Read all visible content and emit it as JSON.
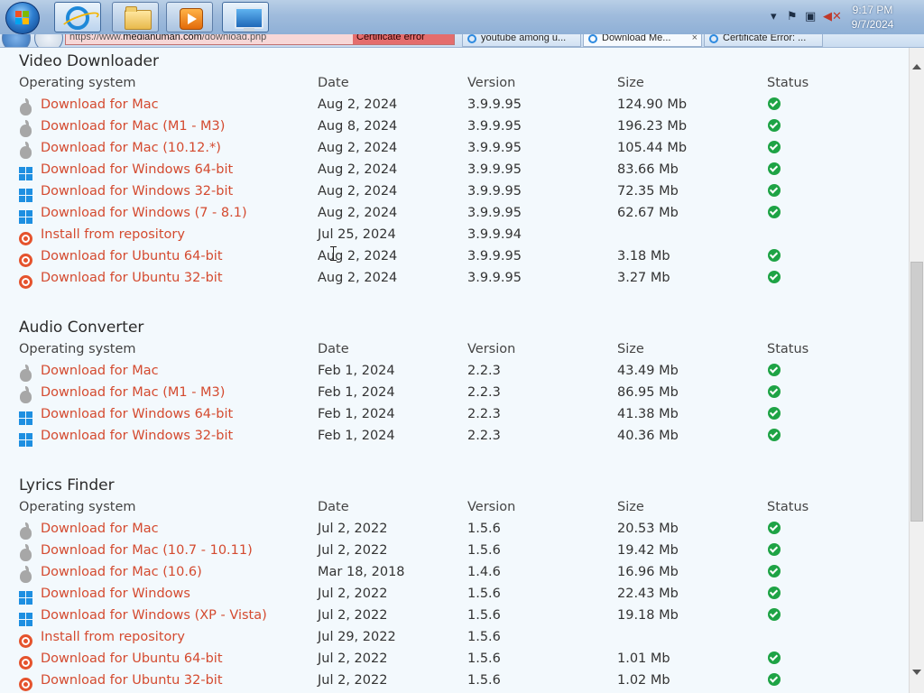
{
  "taskbar": {
    "clock_time": "9:17 PM",
    "clock_date": "9/7/2024",
    "apps": [
      "internet-explorer",
      "file-explorer",
      "media-player",
      "remote-desktop"
    ]
  },
  "browser": {
    "address_host": "mediahuman.com",
    "address_rest": "/download.php",
    "address_prefix": "https://www.",
    "cert_label": "Certificate error",
    "tabs": [
      {
        "label": "youtube among u...",
        "active": false
      },
      {
        "label": "Download Me...",
        "active": true
      },
      {
        "label": "Certificate Error: ...",
        "active": false
      }
    ],
    "tab_close": "×"
  },
  "colors": {
    "link": "#d44a2f",
    "status_ok": "#1ea345",
    "windows_blue": "#1e8fe1",
    "ubuntu_orange": "#e5532d",
    "apple_gray": "#a7a7a7"
  },
  "headers": {
    "os": "Operating system",
    "date": "Date",
    "version": "Version",
    "size": "Size",
    "status": "Status"
  },
  "sections": [
    {
      "title": "Video Downloader",
      "rows": [
        {
          "icon": "apple",
          "label": "Download for Mac",
          "date": "Aug 2, 2024",
          "version": "3.9.9.95",
          "size": "124.90 Mb",
          "ok": true
        },
        {
          "icon": "apple",
          "label": "Download for Mac (M1 - M3)",
          "date": "Aug 8, 2024",
          "version": "3.9.9.95",
          "size": "196.23 Mb",
          "ok": true
        },
        {
          "icon": "apple",
          "label": "Download for Mac (10.12.*)",
          "date": "Aug 2, 2024",
          "version": "3.9.9.95",
          "size": "105.44 Mb",
          "ok": true
        },
        {
          "icon": "windows",
          "label": "Download for Windows 64-bit",
          "date": "Aug 2, 2024",
          "version": "3.9.9.95",
          "size": "83.66 Mb",
          "ok": true
        },
        {
          "icon": "windows",
          "label": "Download for Windows 32-bit",
          "date": "Aug 2, 2024",
          "version": "3.9.9.95",
          "size": "72.35 Mb",
          "ok": true
        },
        {
          "icon": "windows",
          "label": "Download for Windows (7 - 8.1)",
          "date": "Aug 2, 2024",
          "version": "3.9.9.95",
          "size": "62.67 Mb",
          "ok": true
        },
        {
          "icon": "ubuntu",
          "label": "Install from repository",
          "date": "Jul 25, 2024",
          "version": "3.9.9.94",
          "size": "",
          "ok": false
        },
        {
          "icon": "ubuntu",
          "label": "Download for Ubuntu 64-bit",
          "date": "Aug 2, 2024",
          "version": "3.9.9.95",
          "size": "3.18 Mb",
          "ok": true
        },
        {
          "icon": "ubuntu",
          "label": "Download for Ubuntu 32-bit",
          "date": "Aug 2, 2024",
          "version": "3.9.9.95",
          "size": "3.27 Mb",
          "ok": true
        }
      ]
    },
    {
      "title": "Audio Converter",
      "rows": [
        {
          "icon": "apple",
          "label": "Download for Mac",
          "date": "Feb 1, 2024",
          "version": "2.2.3",
          "size": "43.49 Mb",
          "ok": true
        },
        {
          "icon": "apple",
          "label": "Download for Mac (M1 - M3)",
          "date": "Feb 1, 2024",
          "version": "2.2.3",
          "size": "86.95 Mb",
          "ok": true
        },
        {
          "icon": "windows",
          "label": "Download for Windows 64-bit",
          "date": "Feb 1, 2024",
          "version": "2.2.3",
          "size": "41.38 Mb",
          "ok": true
        },
        {
          "icon": "windows",
          "label": "Download for Windows 32-bit",
          "date": "Feb 1, 2024",
          "version": "2.2.3",
          "size": "40.36 Mb",
          "ok": true
        }
      ]
    },
    {
      "title": "Lyrics Finder",
      "rows": [
        {
          "icon": "apple",
          "label": "Download for Mac",
          "date": "Jul 2, 2022",
          "version": "1.5.6",
          "size": "20.53 Mb",
          "ok": true
        },
        {
          "icon": "apple",
          "label": "Download for Mac (10.7 - 10.11)",
          "date": "Jul 2, 2022",
          "version": "1.5.6",
          "size": "19.42 Mb",
          "ok": true
        },
        {
          "icon": "apple",
          "label": "Download for Mac (10.6)",
          "date": "Mar 18, 2018",
          "version": "1.4.6",
          "size": "16.96 Mb",
          "ok": true
        },
        {
          "icon": "windows",
          "label": "Download for Windows",
          "date": "Jul 2, 2022",
          "version": "1.5.6",
          "size": "22.43 Mb",
          "ok": true
        },
        {
          "icon": "windows",
          "label": "Download for Windows (XP - Vista)",
          "date": "Jul 2, 2022",
          "version": "1.5.6",
          "size": "19.18 Mb",
          "ok": true
        },
        {
          "icon": "ubuntu",
          "label": "Install from repository",
          "date": "Jul 29, 2022",
          "version": "1.5.6",
          "size": "",
          "ok": false
        },
        {
          "icon": "ubuntu",
          "label": "Download for Ubuntu 64-bit",
          "date": "Jul 2, 2022",
          "version": "1.5.6",
          "size": "1.01 Mb",
          "ok": true
        },
        {
          "icon": "ubuntu",
          "label": "Download for Ubuntu 32-bit",
          "date": "Jul 2, 2022",
          "version": "1.5.6",
          "size": "1.02 Mb",
          "ok": true
        }
      ]
    }
  ]
}
